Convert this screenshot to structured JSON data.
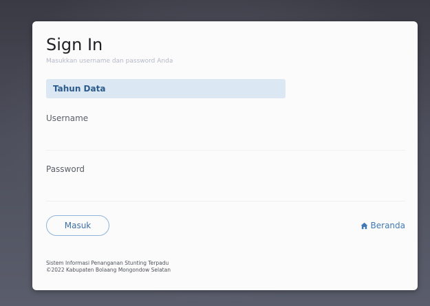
{
  "card": {
    "title": "Sign In",
    "subtitle": "Masukkan username dan password Anda"
  },
  "form": {
    "year_select": "Tahun Data",
    "username_label": "Username",
    "username_value": "",
    "password_label": "Password",
    "password_value": ""
  },
  "actions": {
    "submit_label": "Masuk",
    "home_link_label": "Beranda",
    "home_icon": "home-icon"
  },
  "footer": {
    "line1": "Sistem Informasi Penanganan Stunting Terpadu",
    "line2": "©2022 Kabupaten Bolaang Mongondow Selatan"
  },
  "colors": {
    "accent": "#3f78b3",
    "select_bg": "#dbe7f2"
  }
}
